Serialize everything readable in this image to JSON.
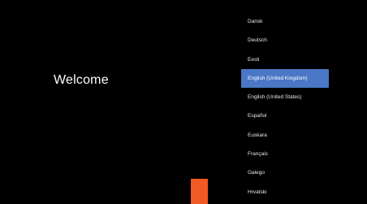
{
  "welcome": {
    "title": "Welcome"
  },
  "languages": {
    "selected_index": 3,
    "items": [
      {
        "label": "Dansk"
      },
      {
        "label": "Deutsch"
      },
      {
        "label": "Eesti"
      },
      {
        "label": "English (United Kingdom)"
      },
      {
        "label": "English (United States)"
      },
      {
        "label": "Español"
      },
      {
        "label": "Euskara"
      },
      {
        "label": "Français"
      },
      {
        "label": "Galego"
      },
      {
        "label": "Hrvatski"
      }
    ]
  },
  "colors": {
    "background": "#000000",
    "selection": "#4a78c7",
    "accent_block": "#f15a22"
  }
}
